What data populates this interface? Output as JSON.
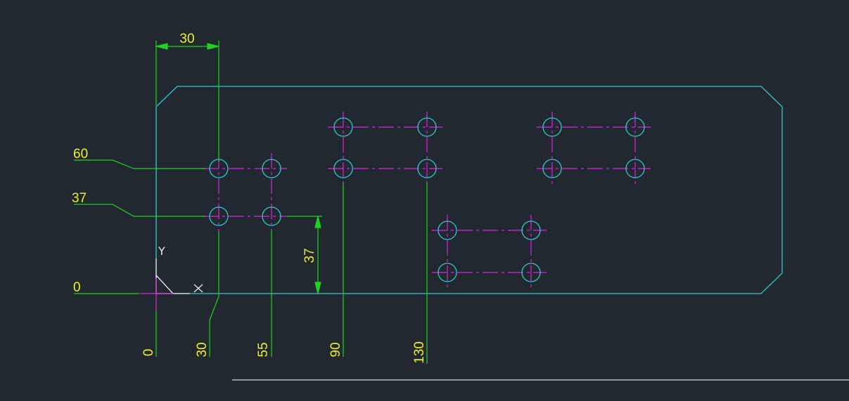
{
  "colors": {
    "background": "#212830",
    "outline": "#2fc8d0",
    "hole": "#2fc8d0",
    "centerline": "#e020e0",
    "dimension": "#1fd21f",
    "dim_text": "#f0f020",
    "ucs": "#e8e8e8",
    "bottom_rule": "#d8d8d8"
  },
  "dimensions": {
    "top_width": "30",
    "vertical_spacing": "37"
  },
  "ordinates_y": [
    "60",
    "37",
    "0"
  ],
  "ordinates_x": [
    "0",
    "30",
    "55",
    "90",
    "130"
  ],
  "ucs": {
    "x_label": "X",
    "y_label": "Y"
  }
}
